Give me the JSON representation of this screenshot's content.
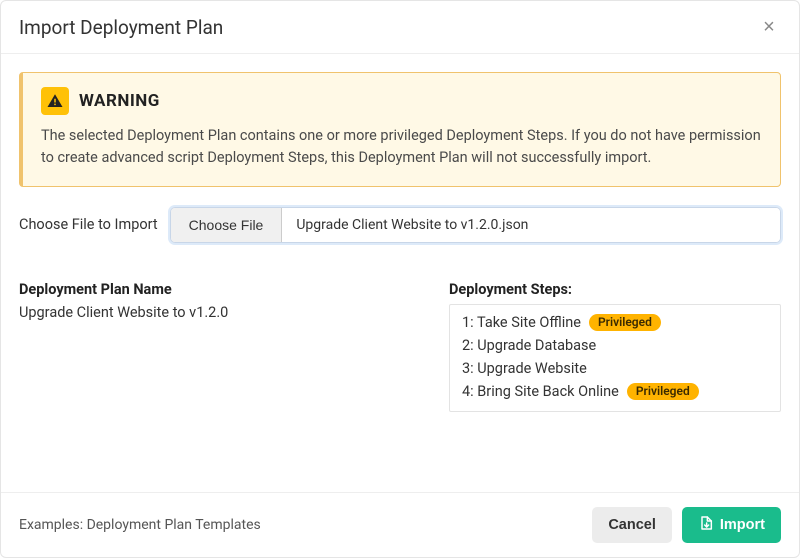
{
  "header": {
    "title": "Import Deployment Plan"
  },
  "warning": {
    "title": "WARNING",
    "text": "The selected Deployment Plan contains one or more privileged Deployment Steps. If you do not have permission to create advanced script Deployment Steps, this Deployment Plan will not successfully import."
  },
  "file": {
    "label": "Choose File to Import",
    "button_label": "Choose File",
    "filename": "Upgrade Client Website to v1.2.0.json"
  },
  "plan": {
    "name_heading": "Deployment Plan Name",
    "name_value": "Upgrade Client Website to v1.2.0",
    "steps_heading": "Deployment Steps:",
    "steps": [
      {
        "num": "1",
        "label": "Take Site Offline",
        "privileged": true
      },
      {
        "num": "2",
        "label": "Upgrade Database",
        "privileged": false
      },
      {
        "num": "3",
        "label": "Upgrade Website",
        "privileged": false
      },
      {
        "num": "4",
        "label": "Bring Site Back Online",
        "privileged": true
      }
    ],
    "privileged_badge_label": "Privileged"
  },
  "footer": {
    "examples_label": "Examples: Deployment Plan Templates",
    "cancel_label": "Cancel",
    "import_label": "Import"
  }
}
